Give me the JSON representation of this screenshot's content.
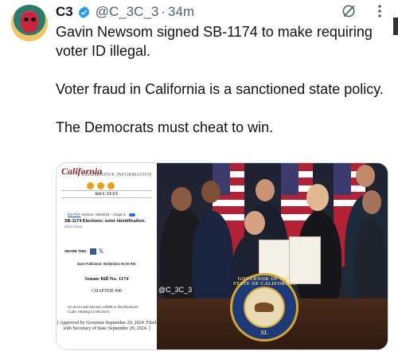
{
  "tweet": {
    "author_name": "C3",
    "handle": "@C_3C_3",
    "separator": "·",
    "time": "34m",
    "text_lines": [
      "Gavin Newsom signed SB-1174 to make requiring voter ID illegal.",
      "Voter fraud in California is a sanctioned state policy.",
      "The Democrats must cheat to win."
    ]
  },
  "media": {
    "document": {
      "logo": "California",
      "site_name": "LEGISLATIVE INFORMATION",
      "section": "BILL TEXT",
      "version_link": "Bill PDF",
      "version_text": "Version: 09/24/24 - Chapt",
      "version_num": "3",
      "subject": "SB-1174 Elections: voter identification.",
      "session": "(2023-2024)",
      "share_label": "SHARE THIS:",
      "share_x": "𝕏",
      "published": "Date Published: 09/30/2024 09:00 PM",
      "bill_number": "Senate Bill No. 1174",
      "chapter": "CHAPTER 990",
      "act": "An act to add Section 10005 to the Elections Code, relating to elections.",
      "approved": "[ Approved by Governor September 29, 2024. Filed with Secretary of State September 29, 2024. ]"
    },
    "photo": {
      "watermark": "@C_3C_3",
      "seal_top": "GOVERNOR OF THE STATE OF CALIFORNIA",
      "seal_bottom": "XL"
    }
  },
  "colors": {
    "verified": "#1d9bf0",
    "text": "#0f1419",
    "muted": "#536471"
  },
  "icons": [
    "verified-badge-icon",
    "grok-icon",
    "more-icon"
  ]
}
